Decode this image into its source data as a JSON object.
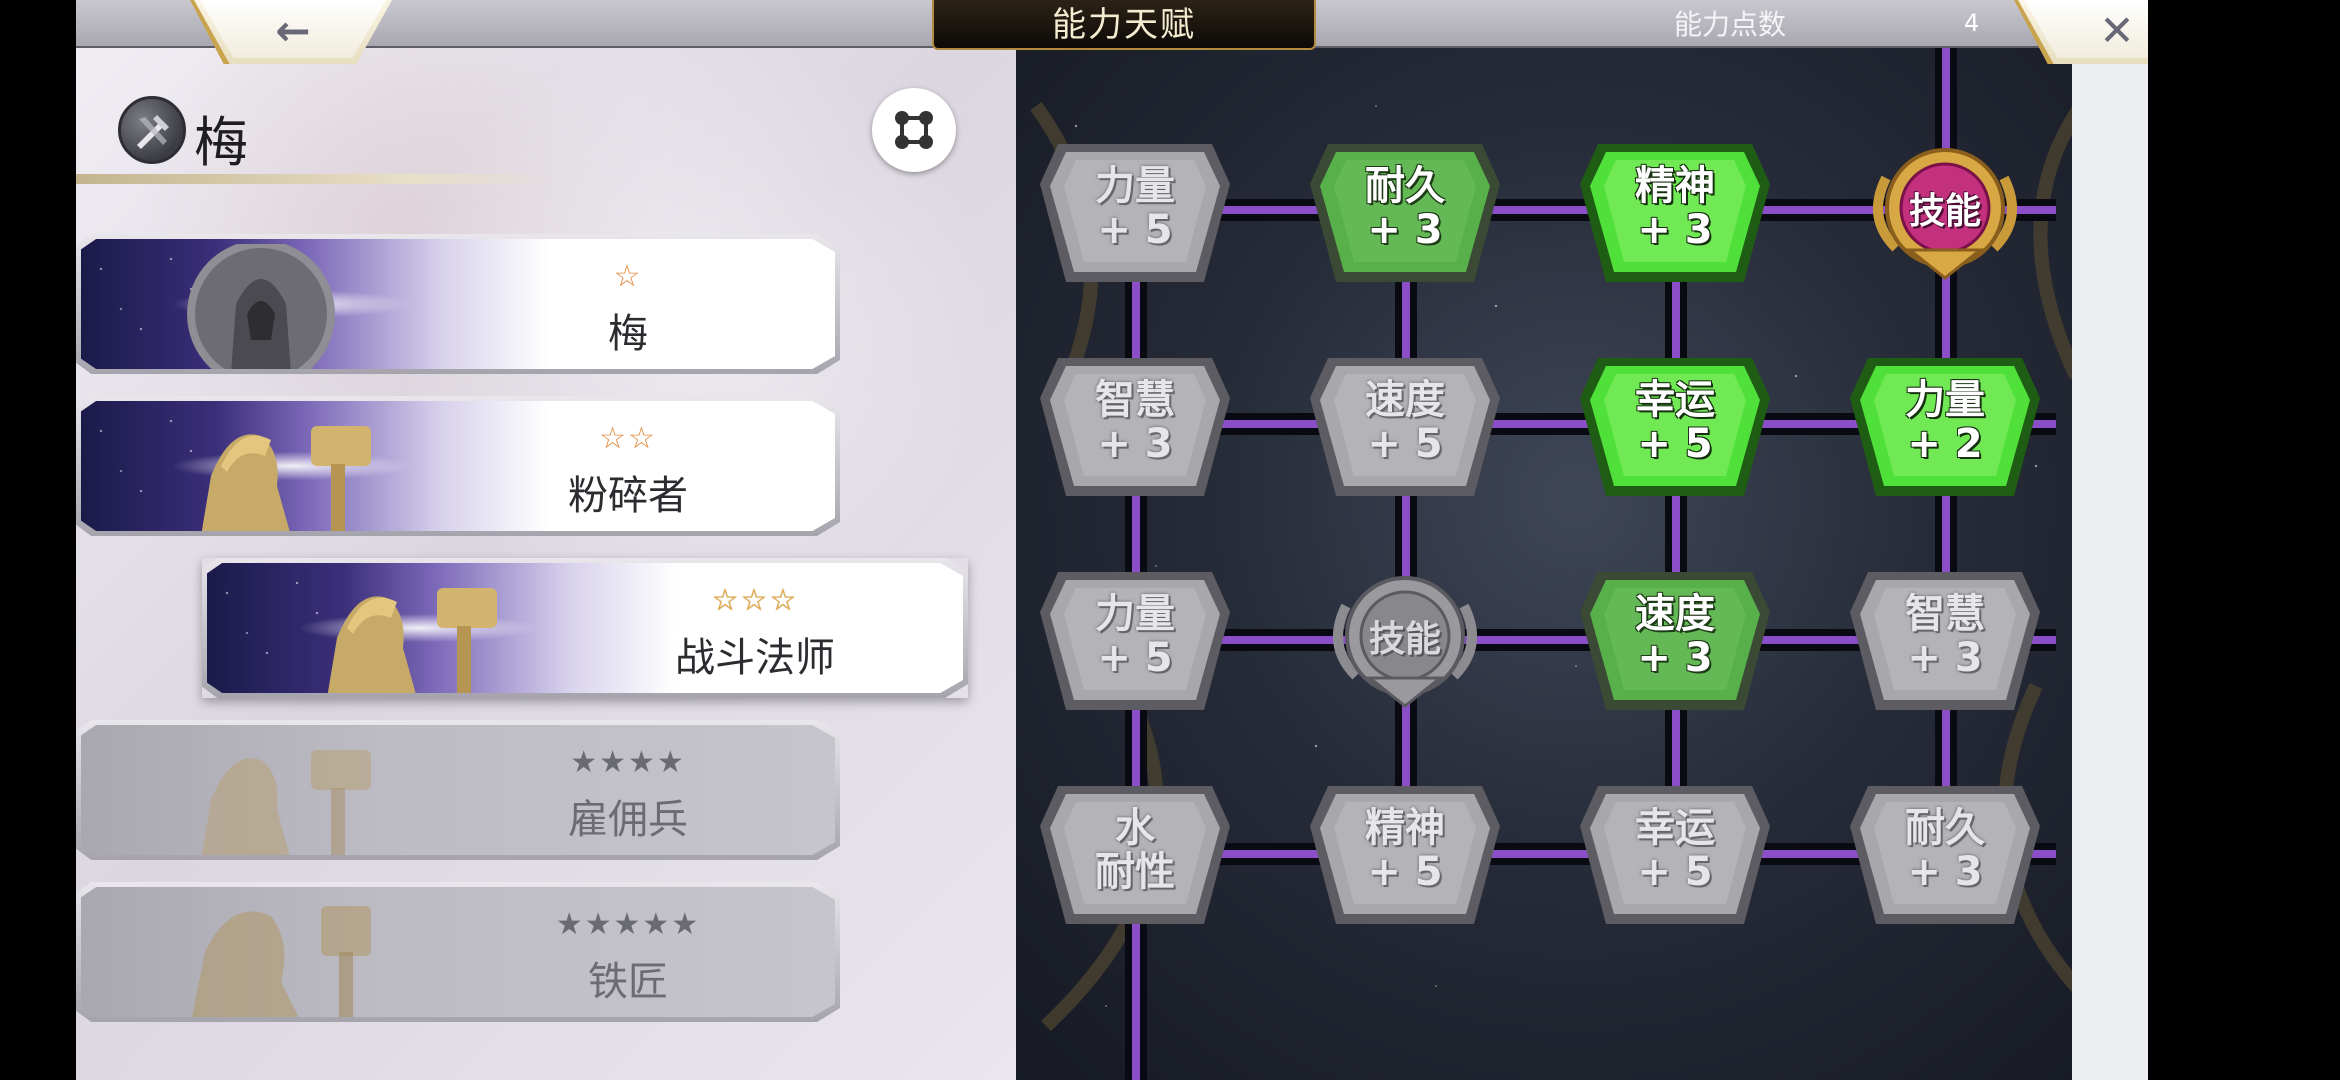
{
  "header": {
    "title": "能力天赋",
    "points_label": "能力点数",
    "points_value": "4",
    "back_glyph": "←",
    "close_glyph": "✕"
  },
  "character": {
    "name": "梅",
    "icon": "class-emblem-icon",
    "toggle_icon": "node-toggle-icon"
  },
  "jobs": [
    {
      "stars": "☆",
      "name": "梅",
      "state": "unlocked"
    },
    {
      "stars": "☆☆",
      "name": "粉碎者",
      "state": "unlocked"
    },
    {
      "stars": "☆☆☆",
      "name": "战斗法师",
      "state": "selected"
    },
    {
      "stars": "★★★★",
      "name": "雇佣兵",
      "state": "locked"
    },
    {
      "stars": "★★★★★",
      "name": "铁匠",
      "state": "locked"
    }
  ],
  "board": {
    "nodes": [
      {
        "l1": "力量",
        "l2": "+ 5",
        "state": "grey"
      },
      {
        "l1": "耐久",
        "l2": "+ 3",
        "state": "green"
      },
      {
        "l1": "精神",
        "l2": "+ 3",
        "state": "bright"
      },
      {
        "l1": "技能",
        "l2": "",
        "state": "skill-active"
      },
      {
        "l1": "智慧",
        "l2": "+ 3",
        "state": "grey"
      },
      {
        "l1": "速度",
        "l2": "+ 5",
        "state": "grey"
      },
      {
        "l1": "幸运",
        "l2": "+ 5",
        "state": "bright"
      },
      {
        "l1": "力量",
        "l2": "+ 2",
        "state": "bright"
      },
      {
        "l1": "力量",
        "l2": "+ 5",
        "state": "grey"
      },
      {
        "l1": "技能",
        "l2": "",
        "state": "skill-inactive"
      },
      {
        "l1": "速度",
        "l2": "+ 3",
        "state": "green"
      },
      {
        "l1": "智慧",
        "l2": "+ 3",
        "state": "grey"
      },
      {
        "l1": "水",
        "l2": "耐性",
        "state": "grey"
      },
      {
        "l1": "精神",
        "l2": "+ 5",
        "state": "grey"
      },
      {
        "l1": "幸运",
        "l2": "+ 5",
        "state": "grey"
      },
      {
        "l1": "耐久",
        "l2": "+ 3",
        "state": "grey"
      }
    ]
  },
  "colors": {
    "link_active": "#9a5ad8",
    "node_grey": "#a8a8ac",
    "node_green": "#57b04a",
    "node_bright": "#4fe03a",
    "skill_gold": "#d7a443",
    "skill_pink": "#c2307e"
  }
}
